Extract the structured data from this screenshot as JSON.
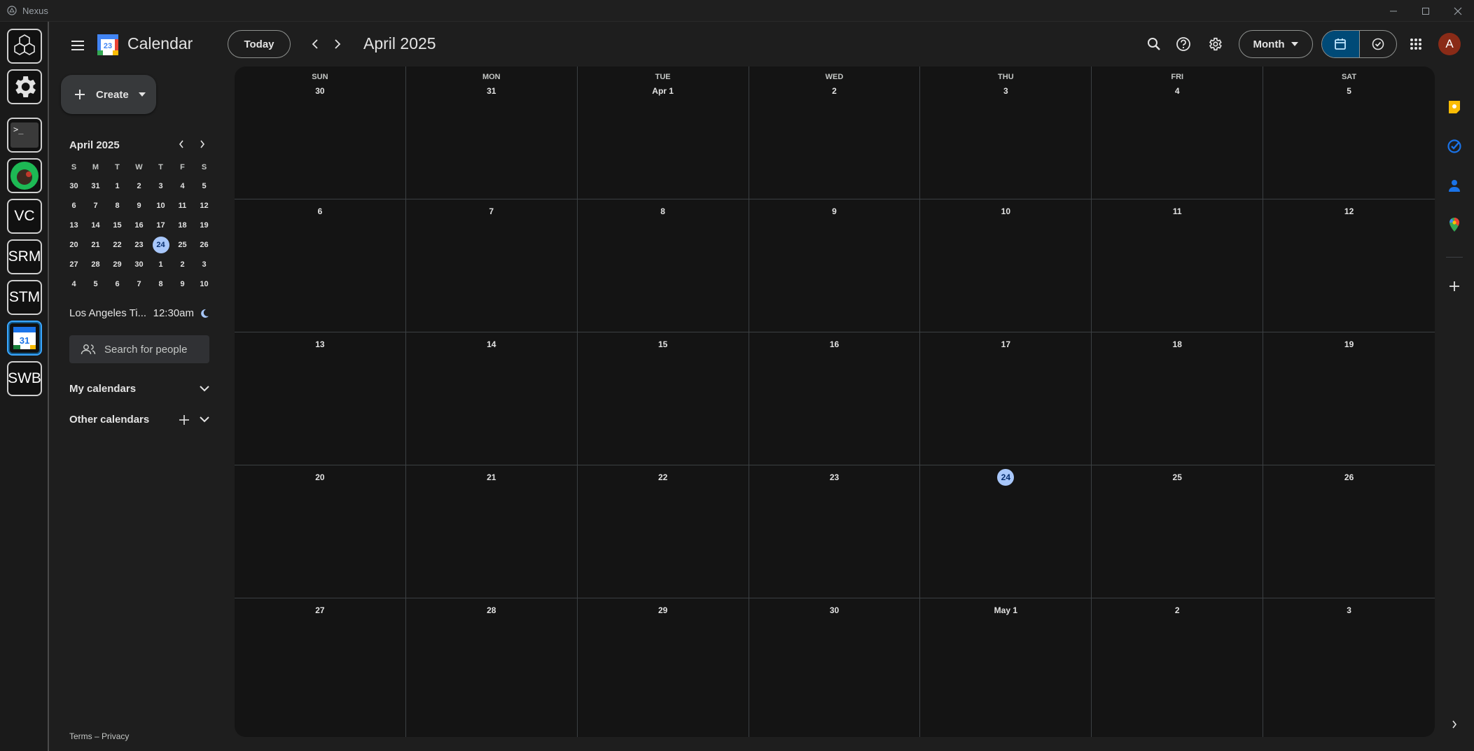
{
  "window": {
    "title": "Nexus"
  },
  "dock": {
    "items": [
      "VC",
      "SRM",
      "STM",
      "SWB"
    ],
    "calendar_icon_text": "31"
  },
  "header": {
    "app_name": "Calendar",
    "logo_text": "23",
    "today_label": "Today",
    "title": "April 2025",
    "view_label": "Month",
    "avatar_letter": "A"
  },
  "sidebar": {
    "create_label": "Create",
    "mini_cal": {
      "title": "April 2025",
      "weekday_heads": [
        "S",
        "M",
        "T",
        "W",
        "T",
        "F",
        "S"
      ],
      "weeks": [
        [
          "30",
          "31",
          "1",
          "2",
          "3",
          "4",
          "5"
        ],
        [
          "6",
          "7",
          "8",
          "9",
          "10",
          "11",
          "12"
        ],
        [
          "13",
          "14",
          "15",
          "16",
          "17",
          "18",
          "19"
        ],
        [
          "20",
          "21",
          "22",
          "23",
          "24",
          "25",
          "26"
        ],
        [
          "27",
          "28",
          "29",
          "30",
          "1",
          "2",
          "3"
        ],
        [
          "4",
          "5",
          "6",
          "7",
          "8",
          "9",
          "10"
        ]
      ],
      "today": "24"
    },
    "timezone": {
      "name": "Los Angeles Ti...",
      "time": "12:30am"
    },
    "people_search_placeholder": "Search for people",
    "my_calendars_label": "My calendars",
    "other_calendars_label": "Other calendars",
    "footer_terms": "Terms",
    "footer_sep": "–",
    "footer_privacy": "Privacy"
  },
  "month_grid": {
    "weekdays": [
      "SUN",
      "MON",
      "TUE",
      "WED",
      "THU",
      "FRI",
      "SAT"
    ],
    "weeks": [
      [
        "30",
        "31",
        "Apr 1",
        "2",
        "3",
        "4",
        "5"
      ],
      [
        "6",
        "7",
        "8",
        "9",
        "10",
        "11",
        "12"
      ],
      [
        "13",
        "14",
        "15",
        "16",
        "17",
        "18",
        "19"
      ],
      [
        "20",
        "21",
        "22",
        "23",
        "24",
        "25",
        "26"
      ],
      [
        "27",
        "28",
        "29",
        "30",
        "May 1",
        "2",
        "3"
      ]
    ],
    "today": "24"
  },
  "colors": {
    "accent": "#a8c7fa",
    "segment_active": "#004a77",
    "avatar_bg": "#8a2b17",
    "keep_yellow": "#fbbc04",
    "tasks_blue": "#1a73e8"
  }
}
